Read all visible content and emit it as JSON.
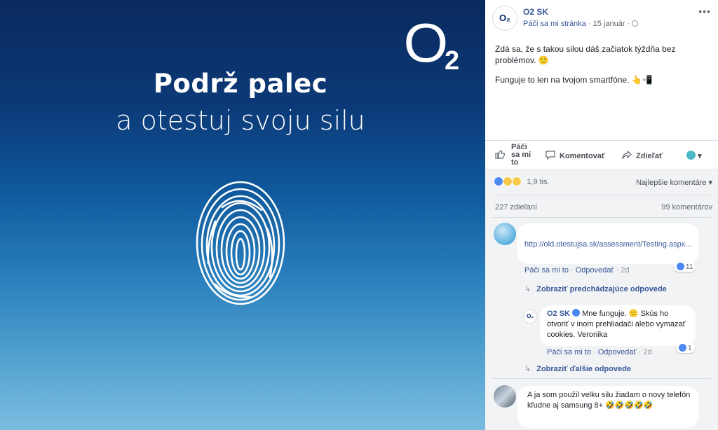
{
  "media": {
    "logo_main": "O",
    "logo_sub": "2",
    "headline_1": "Podrž palec",
    "headline_2": "a otestuj svoju silu"
  },
  "post": {
    "page_name": "O2 SK",
    "avatar_text": "O₂",
    "like_page": "Páči sa mi stránka",
    "separator": " · ",
    "date": "15 január",
    "more": "•••",
    "text_1": "Zdá sa, že s takou silou dáš začiatok týždňa bez problémov. 🙂",
    "text_2": "Funguje to len na tvojom smartfóne. 👆📲"
  },
  "actions": {
    "like_label": "Páči sa mi to",
    "comment_label": "Komentovať",
    "share_label": "Zdieľať",
    "dropdown": "▾"
  },
  "stats": {
    "reaction_count": "1,9 tis.",
    "sort_label": "Najlepšie komentáre ▾",
    "shares": "227 zdieľaní",
    "comments": "99 komentárov"
  },
  "comments": [
    {
      "text": "http://old.otestujsa.sk/assessment/Testing.aspx...",
      "like": "Páči sa mi to",
      "reply": "Odpovedať",
      "time": "2d",
      "reactions": "11",
      "view_replies": "Zobraziť predchádzajúce odpovede"
    },
    {
      "author": "O2 SK",
      "avatar_text": "O₂",
      "text": "Mne funguje. 🙂 Skús ho otvoriť v inom prehliadači alebo vymazať cookies. Veronika",
      "like": "Páči sa mi to",
      "reply": "Odpovedať",
      "time": "2d",
      "reactions": "1",
      "view_replies": "Zobraziť ďalšie odpovede"
    },
    {
      "text": "A ja som použil velku silu žiadam o novy telefón kľudne aj samsung 8+ 🤣🤣🤣🤣🤣"
    }
  ]
}
